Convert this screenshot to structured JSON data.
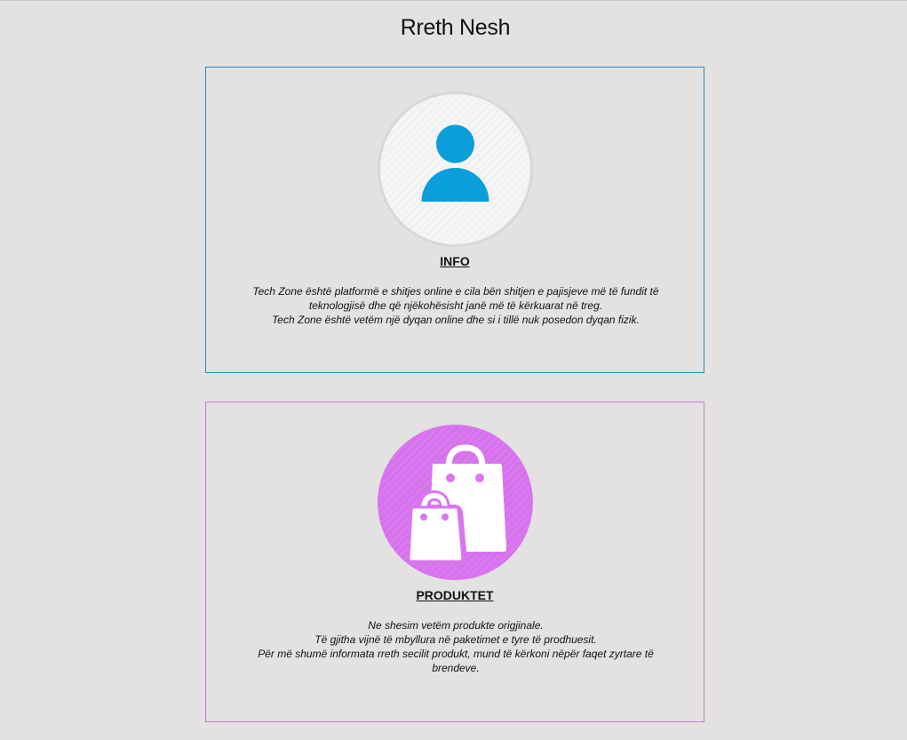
{
  "page": {
    "title": "Rreth Nesh"
  },
  "cards": [
    {
      "heading": "INFO",
      "icon": "user-icon",
      "color": "#199fd9",
      "lines": [
        "Tech Zone është platformë e shitjes online e cila bën shitjen e pajisjeve më të fundit të teknologjisë dhe që njëkohësisht janë më të kërkuarat në treg.",
        "Tech Zone është vetëm një dyqan online dhe si i tillë nuk posedon dyqan fizik."
      ]
    },
    {
      "heading": "PRODUKTET",
      "icon": "shopping-bags-icon",
      "color": "#d977ef",
      "lines": [
        "Ne shesim vetëm produkte origjinale.",
        "Të gjitha vijnë të mbyllura në paketimet e tyre të prodhuesit.",
        "Për më shumë informata rreth secilit produkt, mund të kërkoni nëpër faqet zyrtare të brendeve."
      ]
    }
  ]
}
